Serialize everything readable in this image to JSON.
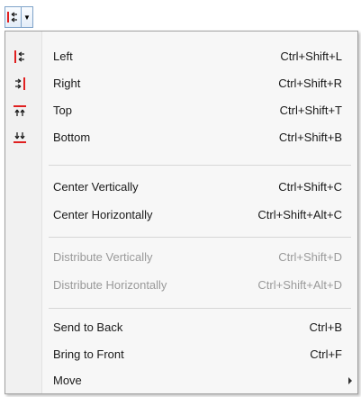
{
  "toolbar": {
    "button_icon": "align-left-icon",
    "dropdown_icon": "chevron-down-icon",
    "dropdown_glyph": "▼"
  },
  "menu": {
    "groups": [
      [
        {
          "label": "Left",
          "shortcut": "Ctrl+Shift+L",
          "icon": "align-left-icon",
          "enabled": true
        },
        {
          "label": "Right",
          "shortcut": "Ctrl+Shift+R",
          "icon": "align-right-icon",
          "enabled": true
        },
        {
          "label": "Top",
          "shortcut": "Ctrl+Shift+T",
          "icon": "align-top-icon",
          "enabled": true
        },
        {
          "label": "Bottom",
          "shortcut": "Ctrl+Shift+B",
          "icon": "align-bottom-icon",
          "enabled": true
        }
      ],
      [
        {
          "label": "Center Vertically",
          "shortcut": "Ctrl+Shift+C",
          "enabled": true
        },
        {
          "label": "Center Horizontally",
          "shortcut": "Ctrl+Shift+Alt+C",
          "enabled": true
        }
      ],
      [
        {
          "label": "Distribute Vertically",
          "shortcut": "Ctrl+Shift+D",
          "enabled": false
        },
        {
          "label": "Distribute Horizontally",
          "shortcut": "Ctrl+Shift+Alt+D",
          "enabled": false
        }
      ],
      [
        {
          "label": "Send to Back",
          "shortcut": "Ctrl+B",
          "enabled": true
        },
        {
          "label": "Bring to Front",
          "shortcut": "Ctrl+F",
          "enabled": true
        },
        {
          "label": "Move",
          "shortcut": "",
          "submenu_icon": "submenu-arrow-icon",
          "enabled": true
        }
      ]
    ]
  },
  "colors": {
    "accent": "#e02020",
    "icon_dark": "#202020"
  }
}
